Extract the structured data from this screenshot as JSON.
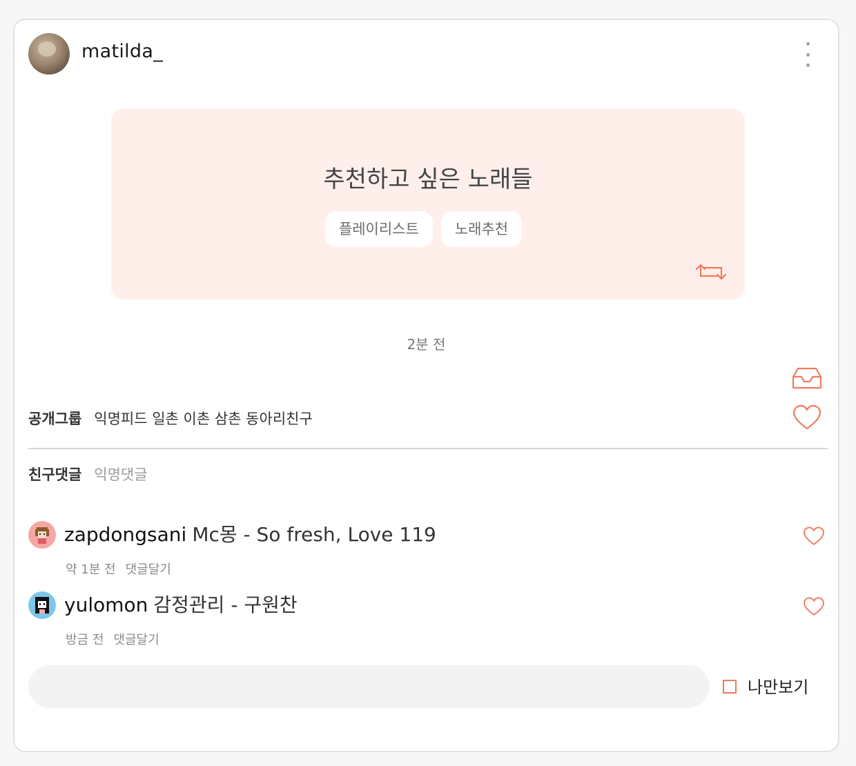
{
  "post": {
    "username": "matilda_",
    "title": "추천하고 싶은 노래들",
    "tags": [
      "플레이리스트",
      "노래추천"
    ],
    "time": "2분 전"
  },
  "group": {
    "label": "공개그룹",
    "names": "익명피드 일촌 이촌 삼촌 동아리친구"
  },
  "comment_tabs": {
    "friend": "친구댓글",
    "anonymous": "익명댓글"
  },
  "comments": [
    {
      "user": "zapdongsani",
      "text": "Mc몽 - So fresh, Love 119",
      "time": "약 1분 전",
      "reply": "댓글달기"
    },
    {
      "user": "yulomon",
      "text": "감정관리 - 구원찬",
      "time": "방금 전",
      "reply": "댓글달기"
    }
  ],
  "composer": {
    "input_value": "",
    "private_label": "나만보기"
  },
  "colors": {
    "accent": "#f07b5f",
    "post_background": "#ffefeb"
  },
  "icons": [
    "more-vertical-icon",
    "repost-icon",
    "inbox-icon",
    "heart-icon"
  ]
}
